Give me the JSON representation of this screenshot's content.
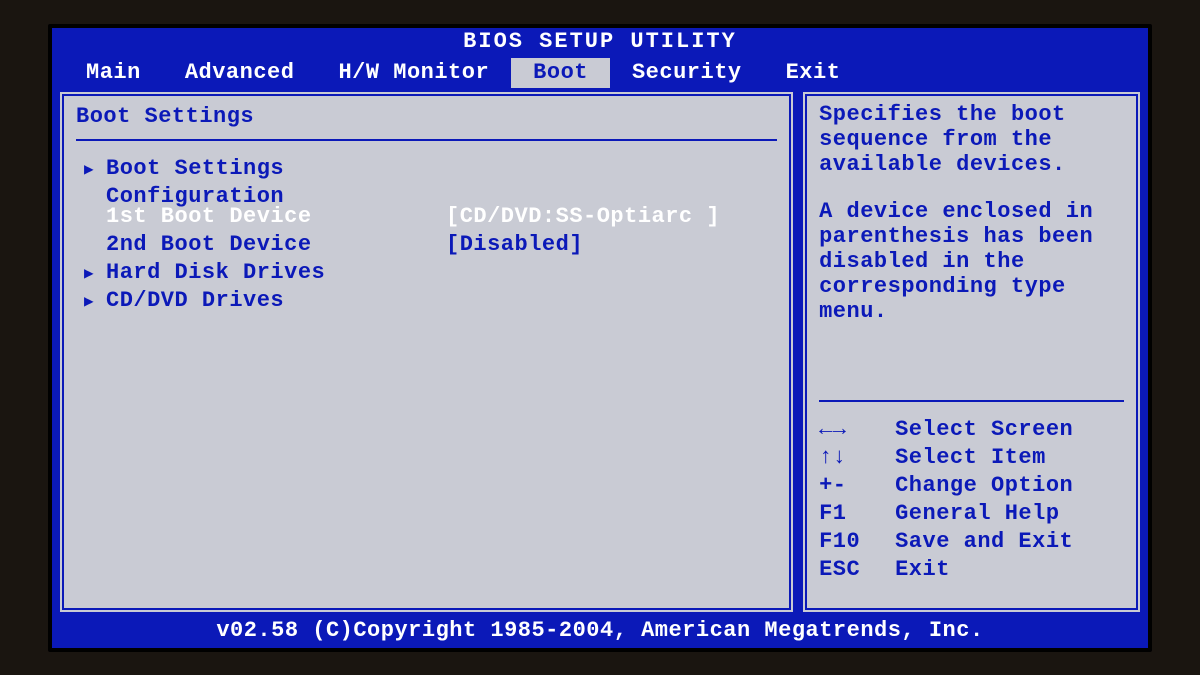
{
  "title": "BIOS SETUP UTILITY",
  "tabs": [
    "Main",
    "Advanced",
    "H/W Monitor",
    "Boot",
    "Security",
    "Exit"
  ],
  "active_tab_index": 3,
  "section_title": "Boot Settings",
  "submenu_link": "Boot Settings Configuration",
  "items": [
    {
      "label": "1st Boot Device",
      "value": "[CD/DVD:SS-Optiarc ]",
      "selected": true
    },
    {
      "label": "2nd Boot Device",
      "value": "[Disabled]",
      "selected": false
    }
  ],
  "sub_links": [
    "Hard Disk Drives",
    "CD/DVD Drives"
  ],
  "help": {
    "p1": "Specifies the boot sequence from the available devices.",
    "p2": "A device enclosed in parenthesis has been disabled in the corresponding type menu."
  },
  "keys": [
    {
      "key": "←→",
      "desc": "Select Screen"
    },
    {
      "key": "↑↓",
      "desc": "Select Item"
    },
    {
      "key": "+-",
      "desc": "Change Option"
    },
    {
      "key": "F1",
      "desc": "General Help"
    },
    {
      "key": "F10",
      "desc": "Save and Exit"
    },
    {
      "key": "ESC",
      "desc": "Exit"
    }
  ],
  "footer": "v02.58 (C)Copyright 1985-2004, American Megatrends, Inc."
}
